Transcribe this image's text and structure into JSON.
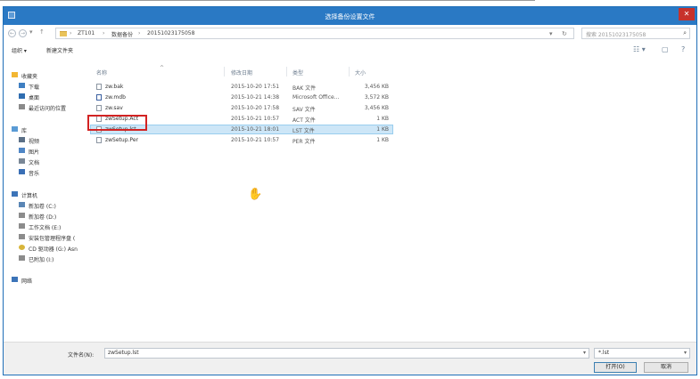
{
  "dialog": {
    "title": "选择备份设置文件",
    "close_glyph": "✕"
  },
  "nav_buttons": {
    "back": "←",
    "forward": "→",
    "dropdown": "▾",
    "up": "↑"
  },
  "address": {
    "crumb_sep": "›",
    "crumbs": [
      "ZT101",
      "数据备份",
      "20151023175058"
    ],
    "dropdown_glyph": "▾",
    "refresh_glyph": "↻"
  },
  "search": {
    "placeholder": "搜索 20151023175058",
    "icon_glyph": "⌕"
  },
  "toolbar": {
    "organize": "组织 ▾",
    "new_folder": "新建文件夹",
    "view_glyph": "☷ ▾",
    "pane_glyph": "▢",
    "help_glyph": "?"
  },
  "sidebar": {
    "items": [
      {
        "label": "收藏夹",
        "icon": "star-icon",
        "color": "#f2b632"
      },
      {
        "label": "下载",
        "icon": "download-icon",
        "color": "#3f7fc2"
      },
      {
        "label": "桌面",
        "icon": "desktop-icon",
        "color": "#2f6db0"
      },
      {
        "label": "最近访问的位置",
        "icon": "recent-places-icon",
        "color": "#8a8a8a"
      },
      {
        "label": "库",
        "icon": "library-icon",
        "color": "#5a9bd5"
      },
      {
        "label": "视频",
        "icon": "video-icon",
        "color": "#5b6f86"
      },
      {
        "label": "图片",
        "icon": "pictures-icon",
        "color": "#4f86c6"
      },
      {
        "label": "文档",
        "icon": "documents-icon",
        "color": "#7a8796"
      },
      {
        "label": "音乐",
        "icon": "music-icon",
        "color": "#3a6fb5"
      },
      {
        "label": "计算机",
        "icon": "computer-icon",
        "color": "#3c74b8"
      },
      {
        "label": "新加卷 (C:)",
        "icon": "drive-c-icon",
        "color": "#5a86b5"
      },
      {
        "label": "新加卷 (D:)",
        "icon": "drive-icon",
        "color": "#8c8c8c"
      },
      {
        "label": "工作文档 (E:)",
        "icon": "drive-icon",
        "color": "#8c8c8c"
      },
      {
        "label": "安装包管理程序盘 (",
        "icon": "drive-icon",
        "color": "#8c8c8c"
      },
      {
        "label": "CD 驱动器 (G:) Asn",
        "icon": "cd-drive-icon",
        "color": "#d8b53a"
      },
      {
        "label": "已附加 (I:)",
        "icon": "drive-icon",
        "color": "#8c8c8c"
      },
      {
        "label": "网络",
        "icon": "network-icon",
        "color": "#3c74b8"
      }
    ]
  },
  "columns": {
    "name": "名称",
    "sort_glyph": "^",
    "date": "修改日期",
    "type": "类型",
    "size": "大小"
  },
  "files": [
    {
      "name": "zw.bak",
      "date": "2015-10-20 17:51",
      "type": "BAK 文件",
      "size": "3,456 KB"
    },
    {
      "name": "zw.mdb",
      "date": "2015-10-21 14:38",
      "type": "Microsoft Office...",
      "size": "3,572 KB"
    },
    {
      "name": "zw.sav",
      "date": "2015-10-20 17:58",
      "type": "SAV 文件",
      "size": "3,456 KB"
    },
    {
      "name": "zwSetup.Act",
      "date": "2015-10-21 10:57",
      "type": "ACT 文件",
      "size": "1 KB"
    },
    {
      "name": "zwSetup.lst",
      "date": "2015-10-21 18:01",
      "type": "LST 文件",
      "size": "1 KB"
    },
    {
      "name": "zwSetup.Per",
      "date": "2015-10-21 10:57",
      "type": "PER 文件",
      "size": "1 KB"
    }
  ],
  "selected_index": 4,
  "footer": {
    "filename_label": "文件名(N):",
    "filename_value": "zwSetup.lst",
    "filetype_value": "*.lst",
    "dropdown_glyph": "▾",
    "open_button": "打开(O)",
    "cancel_button": "取消"
  },
  "cursor_glyph": "✋"
}
